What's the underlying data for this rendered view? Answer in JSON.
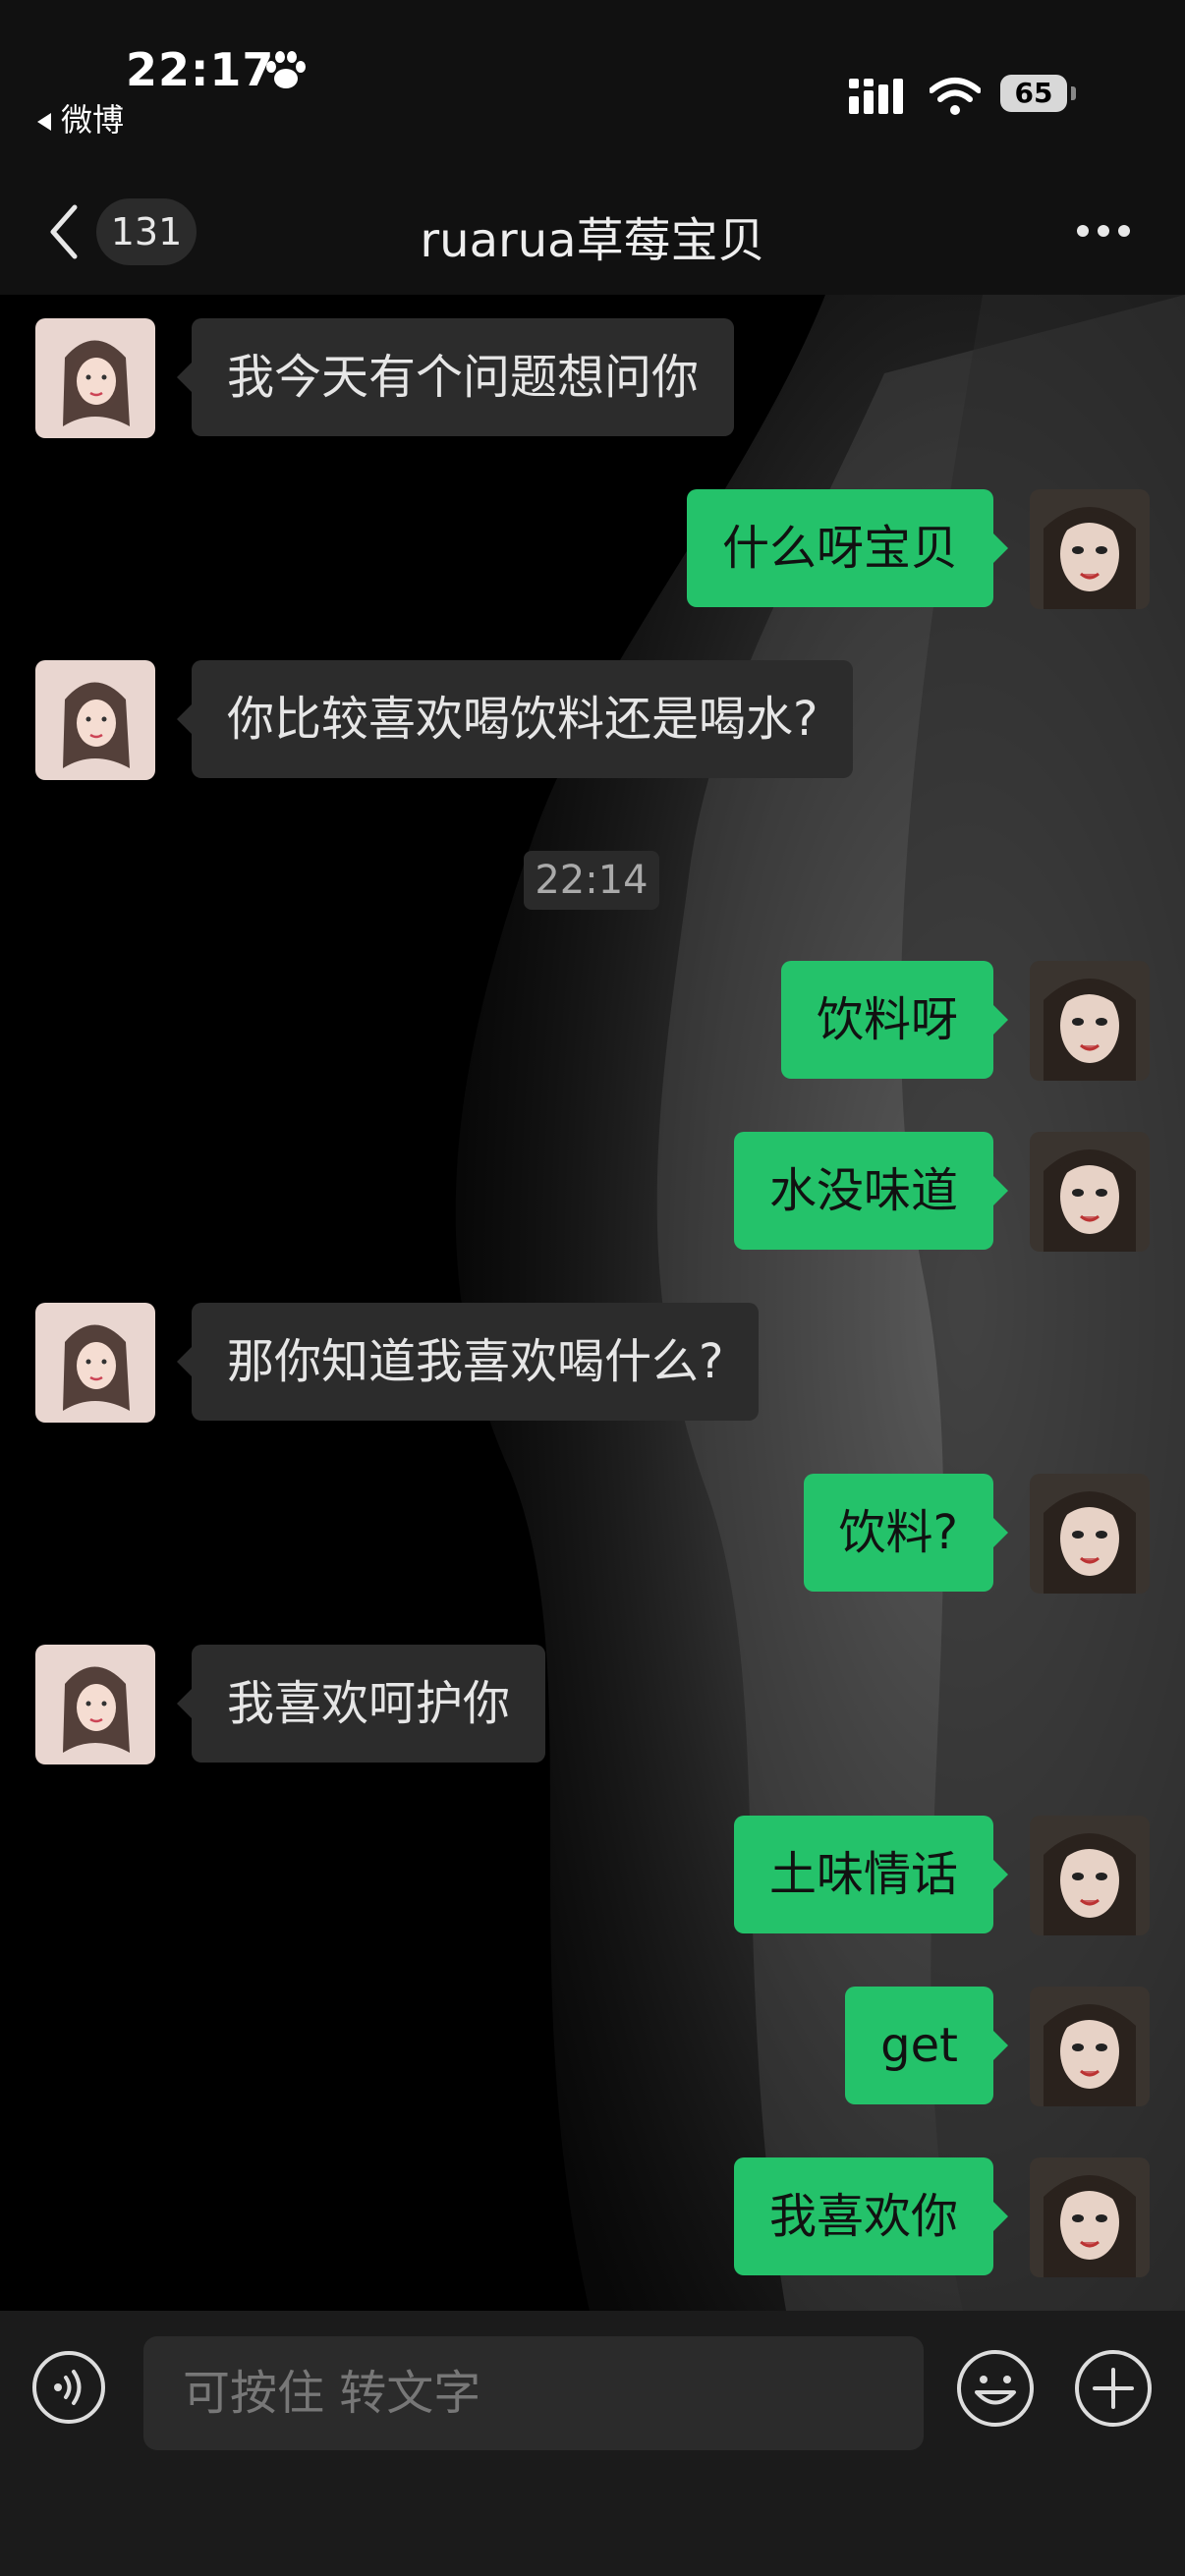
{
  "status_bar": {
    "time": "22:17",
    "back_app": "微博",
    "battery": "65"
  },
  "nav": {
    "unread_count": "131",
    "title": "ruarua草莓宝贝"
  },
  "messages": [
    {
      "side": "in",
      "text": "我今天有个问题想问你"
    },
    {
      "side": "out",
      "text": "什么呀宝贝"
    },
    {
      "side": "in",
      "text": "你比较喜欢喝饮料还是喝水?"
    },
    {
      "side": "out",
      "text": "饮料呀"
    },
    {
      "side": "out",
      "text": "水没味道"
    },
    {
      "side": "in",
      "text": "那你知道我喜欢喝什么?"
    },
    {
      "side": "out",
      "text": "饮料?"
    },
    {
      "side": "in",
      "text": "我喜欢呵护你"
    },
    {
      "side": "out",
      "text": "土味情话"
    },
    {
      "side": "out",
      "text": "get"
    },
    {
      "side": "out",
      "text": "我喜欢你"
    }
  ],
  "timestamp": "22:14",
  "input": {
    "placeholder": "可按住 转文字"
  },
  "colors": {
    "outgoing_bubble": "#24c26a",
    "incoming_bubble": "#2c2c2c",
    "background": "#000000"
  },
  "icons": [
    "paw-icon",
    "signal-icon",
    "wifi-icon",
    "battery-icon",
    "back-chevron-icon",
    "more-icon",
    "voice-icon",
    "emoji-icon",
    "plus-icon"
  ]
}
